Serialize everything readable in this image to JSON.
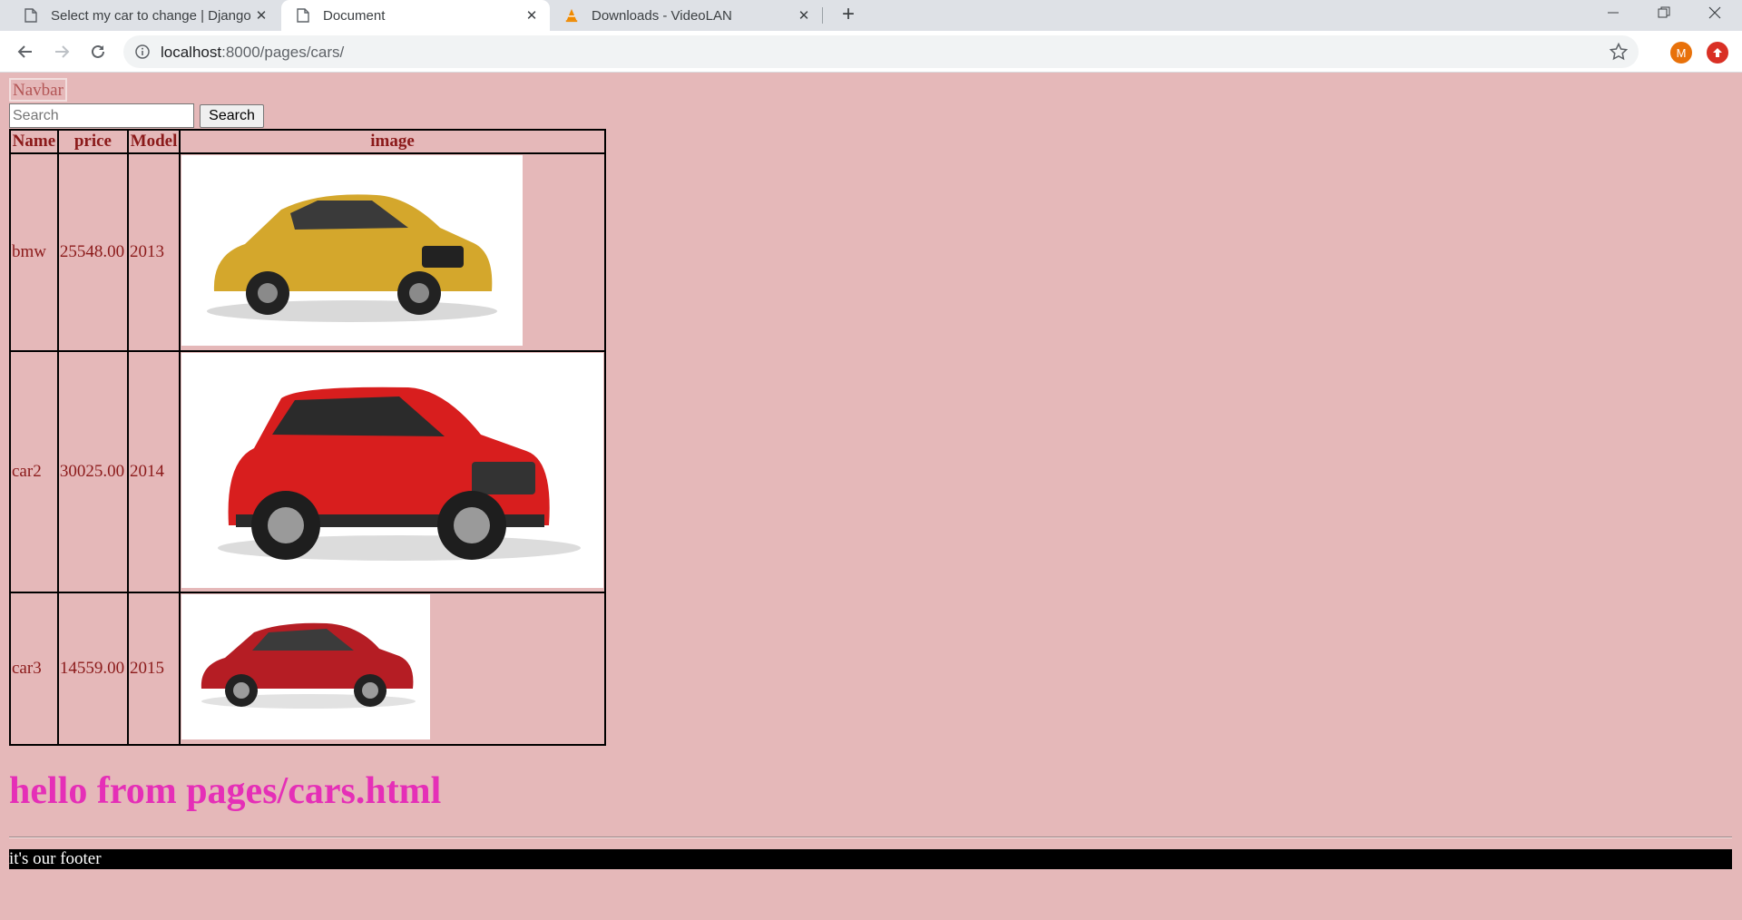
{
  "browser": {
    "tabs": [
      {
        "title": "Select my car to change | Django site admin",
        "icon": "page-icon",
        "active": false
      },
      {
        "title": "Document",
        "icon": "page-icon",
        "active": true
      },
      {
        "title": "Downloads - VideoLAN",
        "icon": "vlc-cone-icon",
        "active": false
      }
    ],
    "address": {
      "host": "localhost",
      "path": ":8000/pages/cars/"
    },
    "profile_initial": "M",
    "colors": {
      "profile": "#e8710a",
      "extension": "#d93025"
    }
  },
  "page": {
    "navbar": "Navbar",
    "search": {
      "placeholder": "Search",
      "button": "Search"
    },
    "table": {
      "headers": [
        "Name",
        "price",
        "Model",
        "image"
      ],
      "rows": [
        {
          "name": "bmw",
          "price": "25548.00",
          "model": "2013",
          "image": "yellow-hatchback-car-image"
        },
        {
          "name": "car2",
          "price": "30025.00",
          "model": "2014",
          "image": "red-suv-car-image"
        },
        {
          "name": "car3",
          "price": "14559.00",
          "model": "2015",
          "image": "red-compact-car-image"
        }
      ]
    },
    "heading": "hello from pages/cars.html",
    "footer": "it's our footer",
    "colors": {
      "background": "#e5b8b9",
      "text": "#8b1a1a",
      "heading": "#e52fb7",
      "footer_bg": "#000000"
    }
  }
}
